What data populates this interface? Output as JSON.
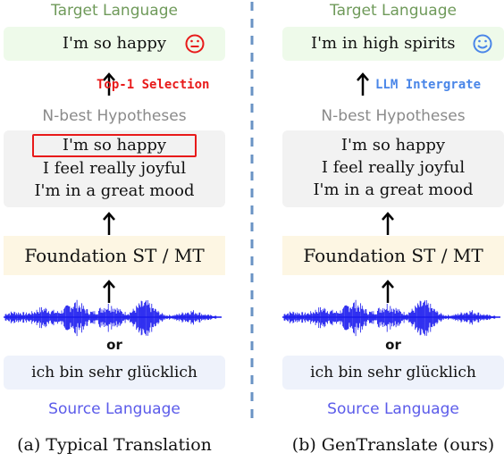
{
  "panels": {
    "a": {
      "target_label": "Target Language",
      "target_text": "I'm so happy",
      "face": "neutral-face",
      "face_color": "#e81a1a",
      "transition_label": "Top-1 Selection",
      "transition_color": "#e81a1a",
      "nbest_label": "N-best Hypotheses",
      "hypotheses": [
        "I'm so happy",
        "I feel really joyful",
        "I'm in a great mood"
      ],
      "highlighted_index": 0,
      "model_label": "Foundation ST / MT",
      "or_label": "or",
      "source_text": "ich bin sehr glücklich",
      "source_label": "Source Language",
      "caption": "(a) Typical Translation"
    },
    "b": {
      "target_label": "Target Language",
      "target_text": "I'm in high spirits",
      "face": "smile-face",
      "face_color": "#4a86e8",
      "transition_label": "LLM Intergrate",
      "transition_color": "#4a86e8",
      "nbest_label": "N-best Hypotheses",
      "hypotheses": [
        "I'm so happy",
        "I feel really joyful",
        "I'm in a great mood"
      ],
      "model_label": "Foundation ST / MT",
      "or_label": "or",
      "source_text": "ich bin sehr glücklich",
      "source_label": "Source Language",
      "caption": "(b) GenTranslate (ours)"
    }
  },
  "colors": {
    "target_green": "#6f9a5a",
    "nbest_gray": "#8a8a8a",
    "source_blue": "#5b5bea",
    "waveform": "#1a1aee",
    "divider": "#6a93c4"
  }
}
